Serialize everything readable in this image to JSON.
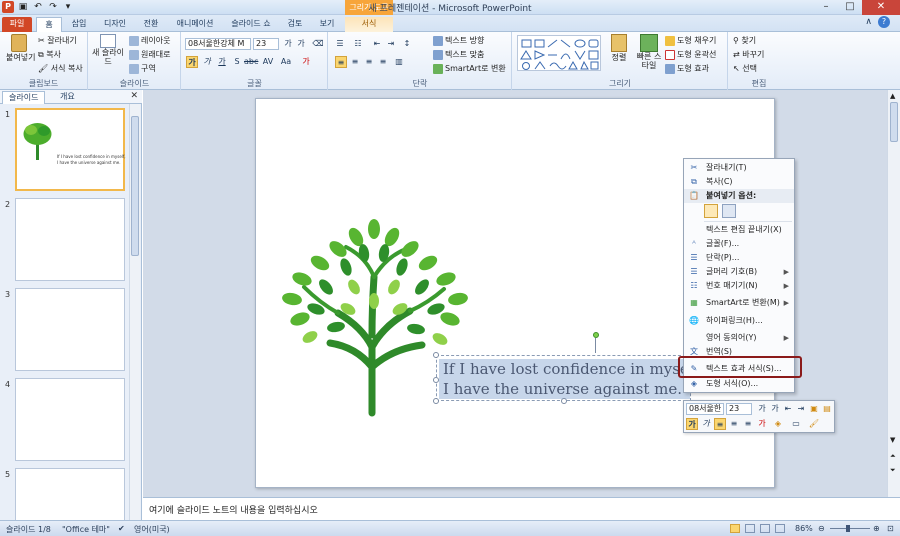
{
  "window": {
    "title": "새 프레젠테이션 - Microsoft PowerPoint",
    "context_tool": "그리기 도구"
  },
  "tabs": [
    "파일",
    "홈",
    "삽입",
    "디자인",
    "전환",
    "애니메이션",
    "슬라이드 쇼",
    "검토",
    "보기",
    "서식"
  ],
  "ribbon": {
    "clipboard": {
      "label": "클립보드",
      "paste": "붙여넣기",
      "cut": "잘라내기",
      "copy": "복사",
      "format_painter": "서식 복사"
    },
    "slides": {
      "label": "슬라이드",
      "new_slide": "새 슬라이드",
      "layout": "레이아웃",
      "reset": "원래대로",
      "section": "구역"
    },
    "font": {
      "label": "글꼴",
      "font_name": "08서울한강체 M",
      "font_size": "23"
    },
    "paragraph": {
      "label": "단락",
      "text_direction": "텍스트 방향",
      "align_text": "텍스트 맞춤",
      "smartart": "SmartArt로 변환"
    },
    "drawing": {
      "label": "그리기",
      "arrange": "정렬",
      "quick_styles": "빠른 스타일",
      "fill": "도형 채우기",
      "outline": "도형 윤곽선",
      "effects": "도형 효과"
    },
    "editing": {
      "label": "편집",
      "find": "찾기",
      "replace": "바꾸기",
      "select": "선택"
    }
  },
  "left_pane": {
    "tab_slides": "슬라이드",
    "tab_outline": "개요",
    "slide_numbers": [
      "1",
      "2",
      "3",
      "4",
      "5"
    ]
  },
  "slide": {
    "line1": "If I have lost confidence in myself,",
    "line2": "I have the universe against me.",
    "thumb_line1": "If I have lost confidence in myself,",
    "thumb_line2": "I have the universe against me."
  },
  "context_menu": {
    "items": [
      "잘라내기(T)",
      "복사(C)",
      "붙여넣기 옵션:",
      "텍스트 편집 끝내기(X)",
      "글꼴(F)...",
      "단락(P)...",
      "글머리 기호(B)",
      "번호 매기기(N)",
      "SmartArt로 변환(M)",
      "하이퍼링크(H)...",
      "영어 동의어(Y)",
      "번역(S)",
      "텍스트 효과 서식(S)...",
      "도형 서식(O)..."
    ]
  },
  "mini_toolbar": {
    "font_name": "08서울한",
    "font_size": "23"
  },
  "notes": {
    "placeholder": "여기에 슬라이드 노트의 내용을 입력하십시오"
  },
  "status": {
    "slide_info": "슬라이드 1/8",
    "theme": "\"Office 테마\"",
    "language": "영어(미국)",
    "zoom": "86%"
  }
}
